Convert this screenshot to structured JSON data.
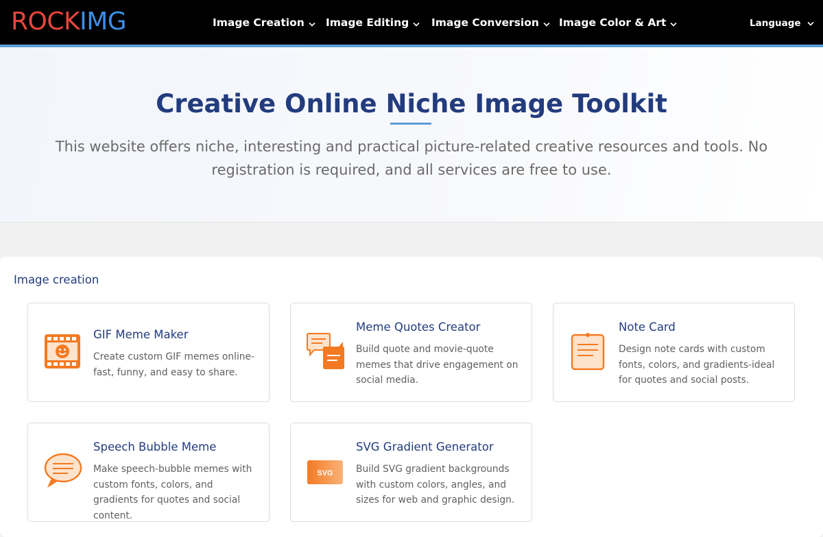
{
  "header": {
    "logo_part1": "ROCK",
    "logo_part2": "IMG",
    "nav": [
      {
        "label": "Image Creation"
      },
      {
        "label": "Image Editing"
      },
      {
        "label": "Image Conversion"
      },
      {
        "label": "Image Color & Art"
      }
    ],
    "language_label": "Language"
  },
  "hero": {
    "title": "Creative Online Niche Image Toolkit",
    "description": "This website offers niche, interesting and practical picture-related creative resources and tools. No registration is required, and all services are free to use."
  },
  "section": {
    "title": "Image creation",
    "cards": [
      {
        "title": "GIF Meme Maker",
        "description": "Create custom GIF memes online-fast, funny, and easy to share.",
        "icon": "gif-film-icon"
      },
      {
        "title": "Meme Quotes Creator",
        "description": "Build quote and movie-quote memes that drive engagement on social media.",
        "icon": "chat-bubbles-icon"
      },
      {
        "title": "Note Card",
        "description": "Design note cards with custom fonts, colors, and gradients-ideal for quotes and social posts.",
        "icon": "note-card-icon"
      },
      {
        "title": "Speech Bubble Meme",
        "description": "Make speech-bubble memes with custom fonts, colors, and gradients for quotes and social content.",
        "icon": "speech-bubble-icon"
      },
      {
        "title": "SVG Gradient Generator",
        "description": "Build SVG gradient backgrounds with custom colors, angles, and sizes for web and graphic design.",
        "icon": "svg-badge-icon",
        "icon_text": "SVG"
      }
    ]
  },
  "colors": {
    "header_bg": "#000000",
    "logo_red": "#e8473c",
    "logo_blue": "#3b8fe5",
    "accent_blue": "#5b9bd5",
    "title_navy": "#233c7e",
    "icon_orange": "#f37a22"
  }
}
